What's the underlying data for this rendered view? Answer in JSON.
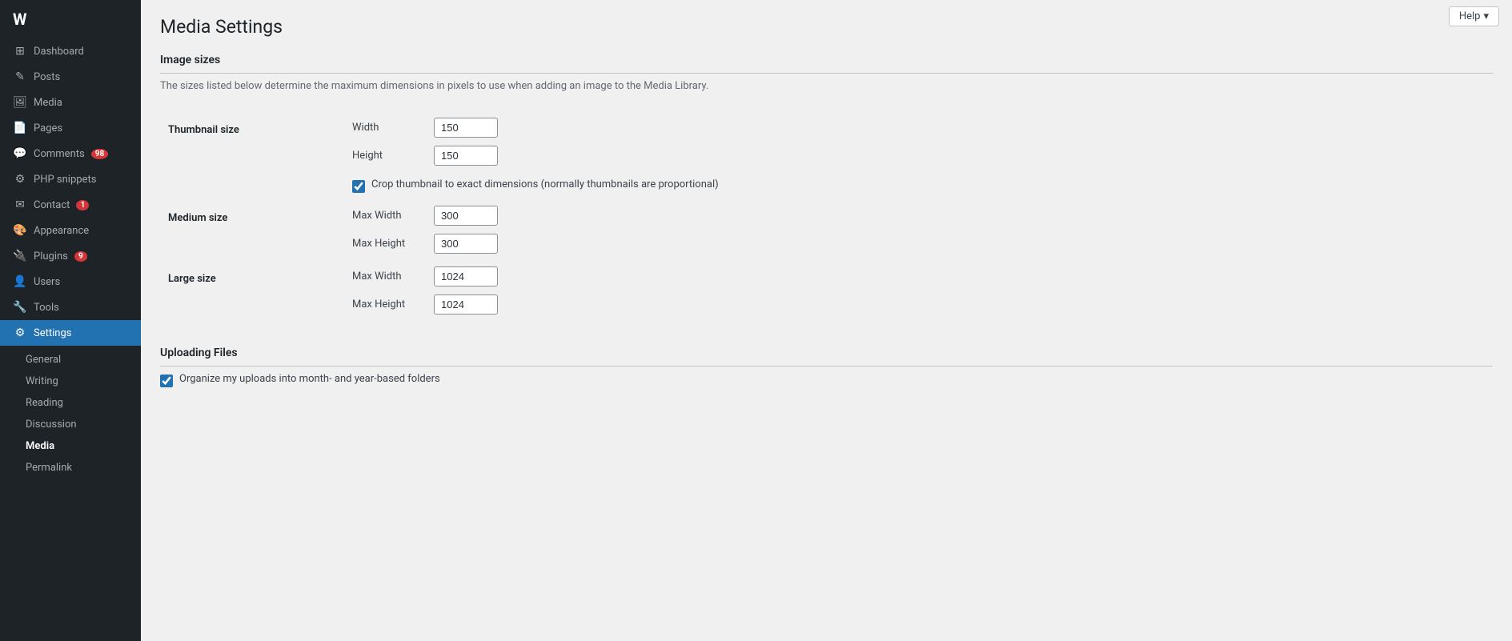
{
  "page": {
    "title": "Media Settings"
  },
  "help": {
    "label": "Help",
    "chevron": "▾"
  },
  "sidebar": {
    "logo": "W",
    "items": [
      {
        "id": "dashboard",
        "label": "Dashboard",
        "icon": "⊞",
        "badge": null
      },
      {
        "id": "posts",
        "label": "Posts",
        "icon": "✎",
        "badge": null
      },
      {
        "id": "media",
        "label": "Media",
        "icon": "⬛",
        "badge": null
      },
      {
        "id": "pages",
        "label": "Pages",
        "icon": "📄",
        "badge": null
      },
      {
        "id": "comments",
        "label": "Comments",
        "icon": "💬",
        "badge": "98"
      },
      {
        "id": "php-snippets",
        "label": "PHP snippets",
        "icon": "⚙",
        "badge": null
      },
      {
        "id": "contact",
        "label": "Contact",
        "icon": "✉",
        "badge": "1"
      },
      {
        "id": "appearance",
        "label": "Appearance",
        "icon": "🎨",
        "badge": null
      },
      {
        "id": "plugins",
        "label": "Plugins",
        "icon": "🔌",
        "badge": "9"
      },
      {
        "id": "users",
        "label": "Users",
        "icon": "👤",
        "badge": null
      },
      {
        "id": "tools",
        "label": "Tools",
        "icon": "🔧",
        "badge": null
      },
      {
        "id": "settings",
        "label": "Settings",
        "icon": "⚙",
        "badge": null,
        "active": true
      }
    ],
    "submenu": [
      {
        "id": "general",
        "label": "General"
      },
      {
        "id": "writing",
        "label": "Writing"
      },
      {
        "id": "reading",
        "label": "Reading"
      },
      {
        "id": "discussion",
        "label": "Discussion"
      },
      {
        "id": "media",
        "label": "Media",
        "active": true
      },
      {
        "id": "permalink",
        "label": "Permalink"
      }
    ]
  },
  "image_sizes": {
    "section_title": "Image sizes",
    "description": "The sizes listed below determine the maximum dimensions in pixels to use when adding an image to the Media Library.",
    "thumbnail": {
      "label": "Thumbnail size",
      "width_label": "Width",
      "width_value": "150",
      "height_label": "Height",
      "height_value": "150",
      "crop_label": "Crop thumbnail to exact dimensions (normally thumbnails are proportional)",
      "crop_checked": true
    },
    "medium": {
      "label": "Medium size",
      "max_width_label": "Max Width",
      "max_width_value": "300",
      "max_height_label": "Max Height",
      "max_height_value": "300"
    },
    "large": {
      "label": "Large size",
      "max_width_label": "Max Width",
      "max_width_value": "1024",
      "max_height_label": "Max Height",
      "max_height_value": "1024"
    }
  },
  "uploading_files": {
    "section_title": "Uploading Files",
    "organize_label": "Organize my uploads into month- and year-based folders",
    "organize_checked": true
  }
}
